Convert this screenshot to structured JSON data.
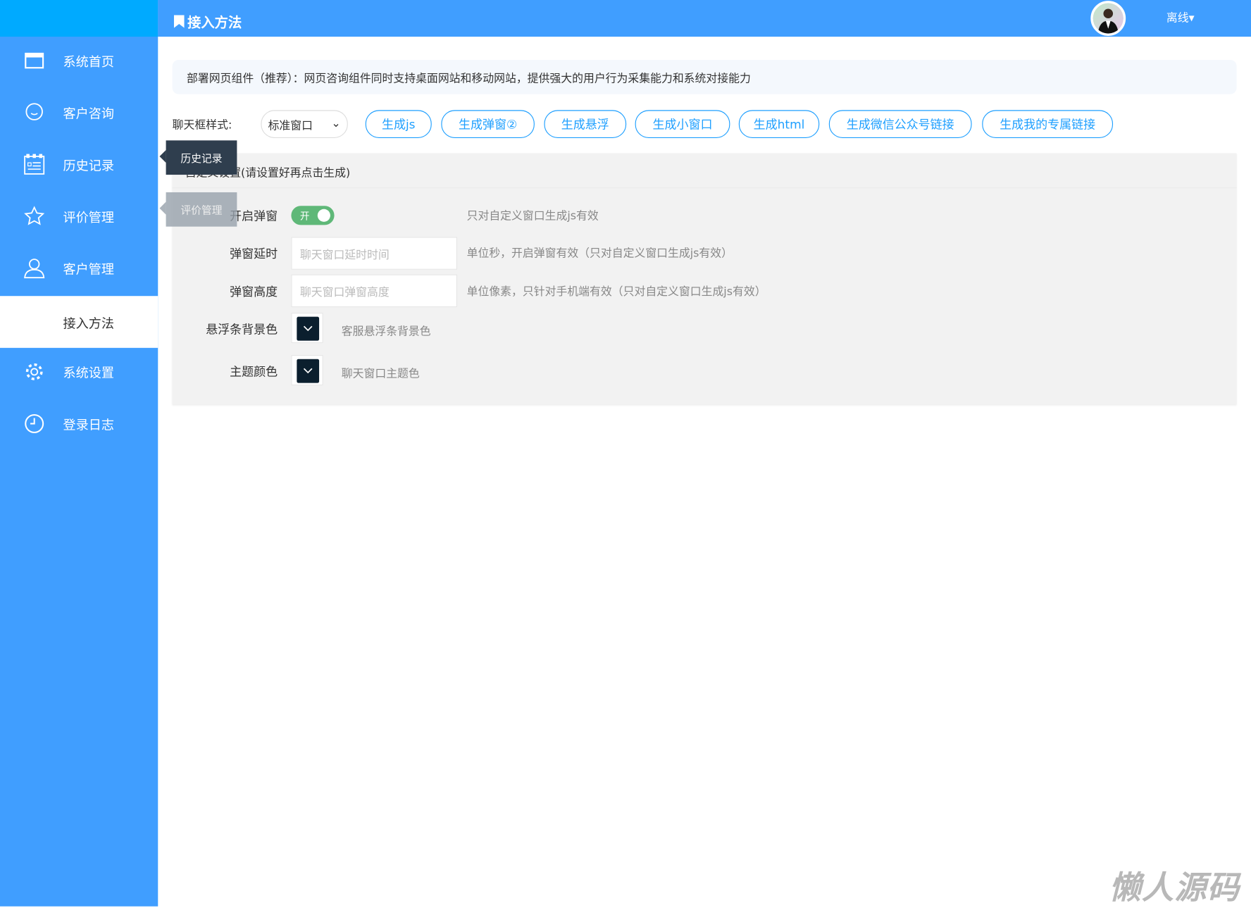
{
  "header": {
    "title": "接入方法",
    "status": "离线",
    "accent": "#409eff"
  },
  "sidebar": {
    "items": [
      {
        "label": "系统首页",
        "icon": "window-icon"
      },
      {
        "label": "客户咨询",
        "icon": "chat-bubble-icon"
      },
      {
        "label": "历史记录",
        "icon": "calendar-list-icon"
      },
      {
        "label": "评价管理",
        "icon": "star-icon"
      },
      {
        "label": "客户管理",
        "icon": "user-icon"
      },
      {
        "label": "接入方法",
        "icon": "",
        "active": true
      },
      {
        "label": "系统设置",
        "icon": "gear-icon"
      },
      {
        "label": "登录日志",
        "icon": "clock-icon"
      }
    ]
  },
  "tooltips": [
    "历史记录",
    "评价管理"
  ],
  "notice": "部署网页组件（推荐）：网页咨询组件同时支持桌面网站和移动网站，提供强大的用户行为采集能力和系统对接能力",
  "chat_style": {
    "label": "聊天框样式:",
    "selected": "标准窗口"
  },
  "buttons": [
    "生成js",
    "生成弹窗②",
    "生成悬浮",
    "生成小窗口",
    "生成html",
    "生成微信公众号链接",
    "生成我的专属链接"
  ],
  "settings": {
    "heading": "自定义设置(请设置好再点击生成)",
    "popup": {
      "label": "开启弹窗",
      "toggle": "开",
      "enabled": true,
      "hint": "只对自定义窗口生成js有效"
    },
    "delay": {
      "label": "弹窗延时",
      "placeholder": "聊天窗口延时时间",
      "hint": "单位秒，开启弹窗有效（只对自定义窗口生成js有效）"
    },
    "height": {
      "label": "弹窗高度",
      "placeholder": "聊天窗口弹窗高度",
      "hint": "单位像素，只针对手机端有效（只对自定义窗口生成js有效）"
    },
    "float_bg": {
      "label": "悬浮条背景色",
      "hint": "客服悬浮条背景色",
      "color": "#0b1f2e"
    },
    "theme": {
      "label": "主题颜色",
      "hint": "聊天窗口主题色",
      "color": "#0b1f2e"
    }
  },
  "watermark": "懒人源码"
}
